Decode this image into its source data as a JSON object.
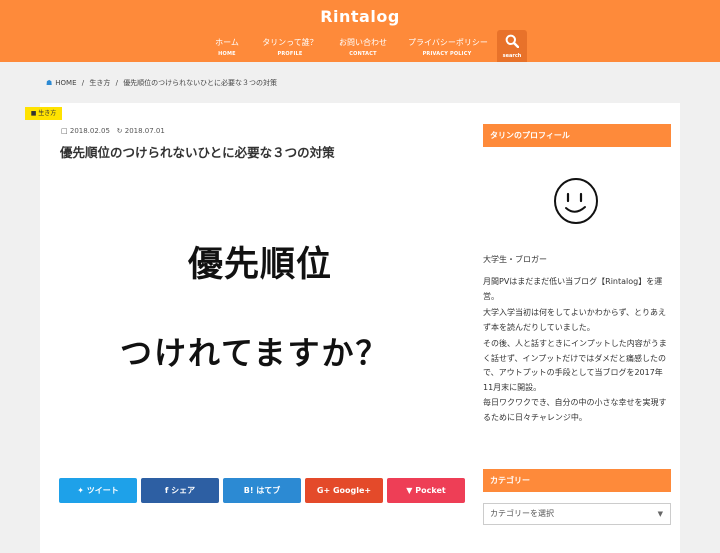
{
  "site": {
    "title": "Rintalog"
  },
  "nav": [
    {
      "jp": "ホーム",
      "en": "HOME"
    },
    {
      "jp": "タリンって誰？",
      "en": "PROFILE"
    },
    {
      "jp": "お問い合わせ",
      "en": "CONTACT"
    },
    {
      "jp": "プライバシーポリシー",
      "en": "PRIVACY POLICY"
    }
  ],
  "search": {
    "label": "search"
  },
  "breadcrumb": {
    "home": "HOME",
    "sep": "/",
    "category": "生き方",
    "current": "優先順位のつけられないひとに必要な３つの対策"
  },
  "article": {
    "category_badge": "生き方",
    "published": "2018.02.05",
    "updated": "2018.07.01",
    "title": "優先順位のつけられないひとに必要な３つの対策",
    "eyecatch_line1": "優先順位",
    "eyecatch_line2": "つけれてますか？"
  },
  "share": {
    "tweet": "ツイート",
    "facebook": "シェア",
    "hatena": "B! はてブ",
    "google": "Google+",
    "pocket": "Pocket",
    "colors": {
      "tweet": "#1ea1e9",
      "facebook": "#2d5fa3",
      "hatena": "#2c8ad3",
      "google": "#e44a2a",
      "pocket": "#ee3e56"
    }
  },
  "sidebar": {
    "profile_heading": "タリンのプロフィール",
    "bio": [
      "大学生・ブロガー",
      "月間PVはまだまだ低い当ブログ【Rintalog】を運営。",
      "大学入学当初は何をしてよいかわからず、とりあえず本を読んだりしていました。",
      "その後、人と話すときにインプットした内容がうまく話せず、インプットだけではダメだと痛感したので、アウトプットの手段として当ブログを2017年11月末に開設。",
      "毎日ワクワクでき、自分の中の小さな幸せを実現するために日々チャレンジ中。"
    ],
    "category_heading": "カテゴリー",
    "category_select": "カテゴリーを選択"
  },
  "colors": {
    "accent": "#fe8a3a",
    "badge": "#ffe200"
  }
}
